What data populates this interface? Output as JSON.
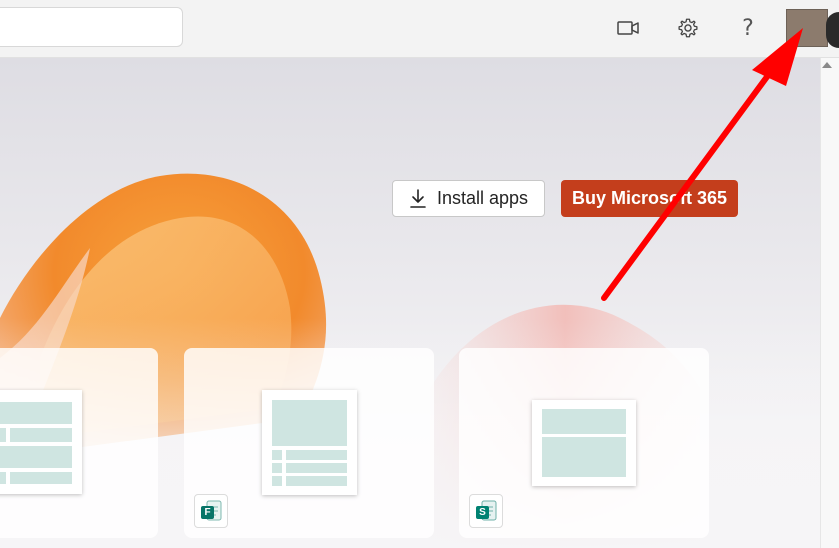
{
  "header": {
    "icons": {
      "video": "video-camera-icon",
      "settings": "gear-icon",
      "help": "question-mark-icon",
      "avatar": "user-avatar"
    },
    "help_glyph": "?"
  },
  "hero": {
    "install_apps_label": "Install apps",
    "buy_label": "Buy Microsoft 365"
  },
  "cards": [
    {
      "app_icon": null
    },
    {
      "app_icon": "forms-icon",
      "app_letter": "F"
    },
    {
      "app_icon": "sway-icon",
      "app_letter": "S"
    }
  ],
  "colors": {
    "buy_button": "#c43e1c",
    "annotation_arrow": "#ff0000",
    "thumb_fill": "#cfe5e1",
    "forms_green": "#077568",
    "sway_teal": "#008272"
  }
}
